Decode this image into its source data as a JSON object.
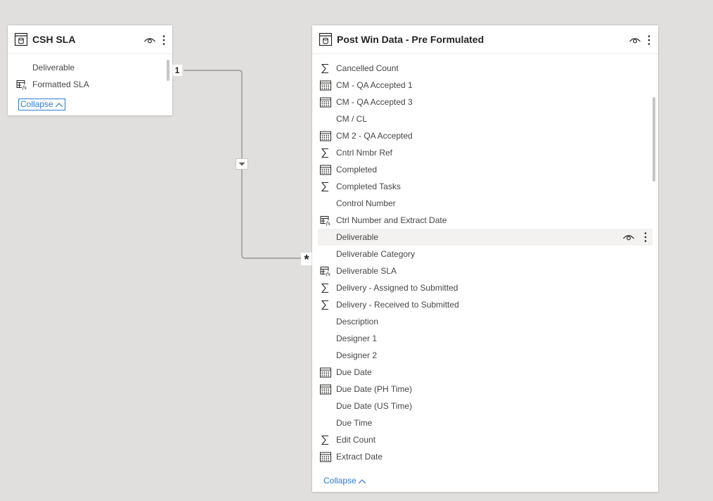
{
  "csh_sla": {
    "title": "CSH SLA",
    "table_icon": "table-icon",
    "visibility_icon": "eye-icon",
    "more_icon": "more-vertical-icon",
    "fields": [
      {
        "label": "Deliverable",
        "icon": "none"
      },
      {
        "label": "Formatted SLA",
        "icon": "calculated-column-icon"
      }
    ],
    "collapse_label": "Collapse"
  },
  "post_win": {
    "title": "Post Win Data - Pre Formulated",
    "table_icon": "table-icon",
    "visibility_icon": "eye-icon",
    "more_icon": "more-vertical-icon",
    "fields": [
      {
        "label": "Cancelled Count",
        "icon": "sigma-icon"
      },
      {
        "label": "CM - QA Accepted 1",
        "icon": "calendar-icon"
      },
      {
        "label": "CM - QA Accepted 3",
        "icon": "calendar-icon"
      },
      {
        "label": "CM / CL",
        "icon": "none"
      },
      {
        "label": "CM 2 - QA Accepted",
        "icon": "calendar-icon"
      },
      {
        "label": "Cntrl Nmbr Ref",
        "icon": "sigma-icon"
      },
      {
        "label": "Completed",
        "icon": "calendar-icon"
      },
      {
        "label": "Completed Tasks",
        "icon": "sigma-icon"
      },
      {
        "label": "Control Number",
        "icon": "none"
      },
      {
        "label": "Ctrl Number and Extract Date",
        "icon": "calculated-column-icon"
      },
      {
        "label": "Deliverable",
        "icon": "none",
        "hovered": true
      },
      {
        "label": "Deliverable Category",
        "icon": "none"
      },
      {
        "label": "Deliverable SLA",
        "icon": "calculated-column-icon"
      },
      {
        "label": "Delivery - Assigned to Submitted",
        "icon": "sigma-icon"
      },
      {
        "label": "Delivery - Received to Submitted",
        "icon": "sigma-icon"
      },
      {
        "label": "Description",
        "icon": "none"
      },
      {
        "label": "Designer 1",
        "icon": "none"
      },
      {
        "label": "Designer 2",
        "icon": "none"
      },
      {
        "label": "Due Date",
        "icon": "calendar-icon"
      },
      {
        "label": "Due Date (PH Time)",
        "icon": "calendar-icon"
      },
      {
        "label": "Due Date (US Time)",
        "icon": "none"
      },
      {
        "label": "Due Time",
        "icon": "none"
      },
      {
        "label": "Edit Count",
        "icon": "sigma-icon"
      },
      {
        "label": "Extract Date",
        "icon": "calendar-icon"
      }
    ],
    "collapse_label": "Collapse"
  },
  "relationship": {
    "from_cardinality": "1",
    "to_cardinality": "*",
    "filter_direction_icon": "filter-direction-arrow-icon"
  },
  "colors": {
    "canvas": "#e1dfdd",
    "card": "#ffffff",
    "link": "#2b7cd3",
    "line": "#8a8886",
    "hover_row": "#f3f2f1"
  }
}
